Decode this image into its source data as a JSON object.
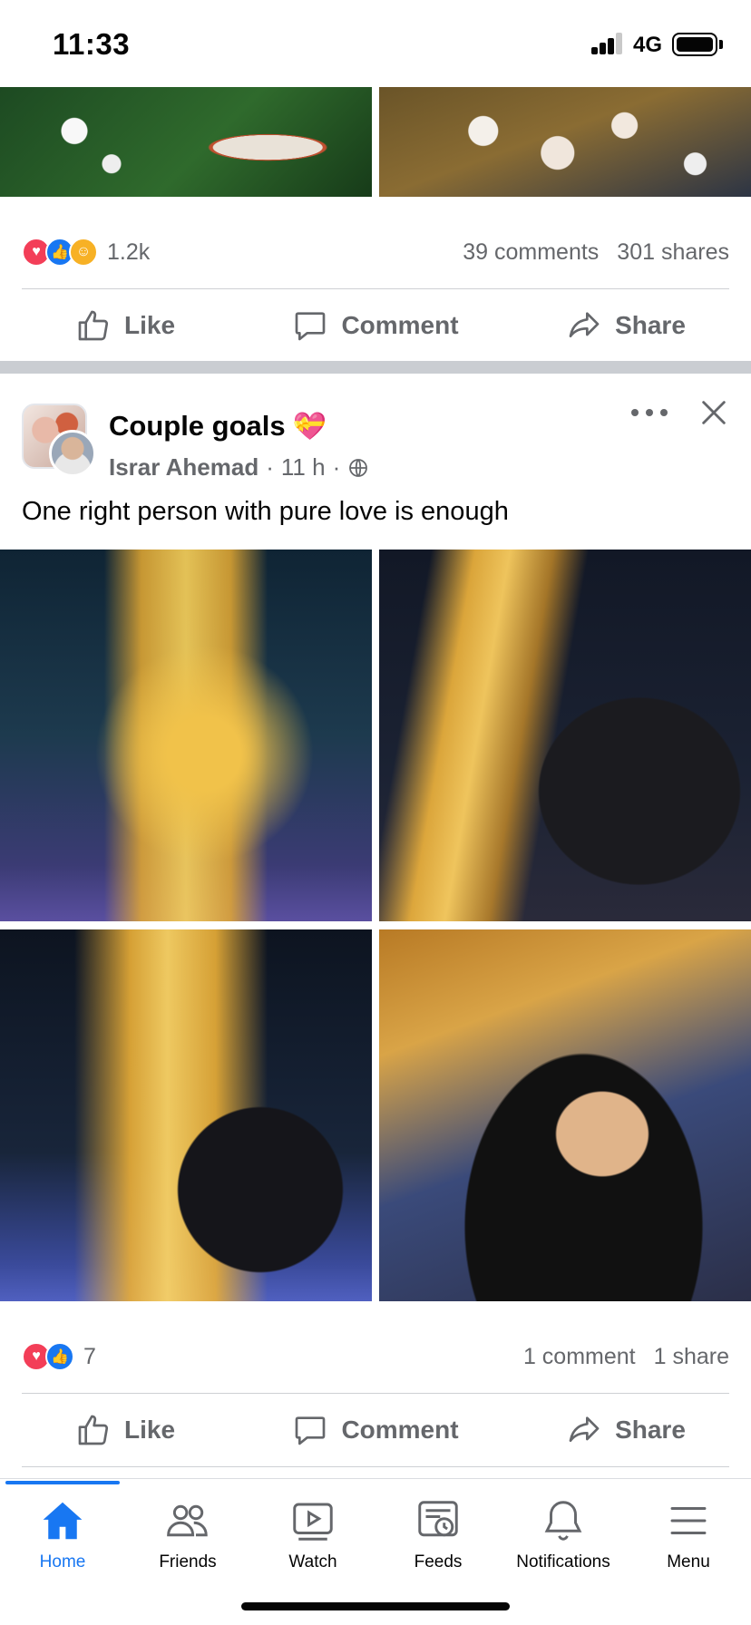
{
  "status_bar": {
    "time": "11:33",
    "network": "4G"
  },
  "post1": {
    "reactions": [
      "love",
      "like",
      "care"
    ],
    "reaction_count": "1.2k",
    "comments": "39 comments",
    "shares": "301 shares",
    "actions": {
      "like": "Like",
      "comment": "Comment",
      "share": "Share"
    }
  },
  "post2": {
    "title": "Couple goals",
    "title_emoji": "💝",
    "author": "Israr Ahemad",
    "time": "11 h",
    "privacy_icon": "globe-icon",
    "text": "One right person with pure love is enough",
    "reactions": [
      "love",
      "like"
    ],
    "reaction_count": "7",
    "comments": "1 comment",
    "shares": "1 share",
    "actions": {
      "like": "Like",
      "comment": "Comment",
      "share": "Share"
    }
  },
  "tabbar": {
    "items": [
      {
        "label": "Home",
        "icon": "home-icon",
        "active": true
      },
      {
        "label": "Friends",
        "icon": "friends-icon",
        "active": false
      },
      {
        "label": "Watch",
        "icon": "watch-icon",
        "active": false
      },
      {
        "label": "Feeds",
        "icon": "feeds-icon",
        "active": false
      },
      {
        "label": "Notifications",
        "icon": "bell-icon",
        "active": false
      },
      {
        "label": "Menu",
        "icon": "menu-icon",
        "active": false
      }
    ]
  },
  "colors": {
    "accent": "#1877f2",
    "muted_text": "#65676b",
    "love": "#f33e58",
    "care": "#f7b125"
  }
}
